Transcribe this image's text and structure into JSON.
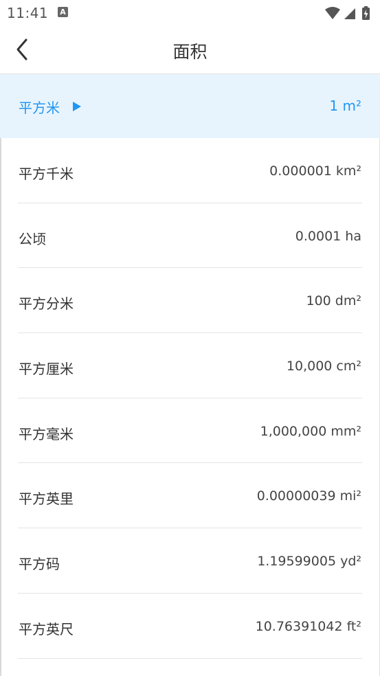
{
  "status_bar": {
    "time": "11:41",
    "app_icon_letter": "A",
    "icons": [
      "wifi-icon",
      "cell-signal-icon",
      "battery-charging-icon"
    ]
  },
  "nav": {
    "title": "面积",
    "back_icon": "chevron-left-icon"
  },
  "selected_unit": {
    "name": "平方米",
    "value": "1 m²",
    "indicator_icon": "triangle-right-icon"
  },
  "units": [
    {
      "name": "平方千米",
      "value": "0.000001 km²"
    },
    {
      "name": "公顷",
      "value": "0.0001 ha"
    },
    {
      "name": "平方分米",
      "value": "100 dm²"
    },
    {
      "name": "平方厘米",
      "value": "10,000 cm²"
    },
    {
      "name": "平方毫米",
      "value": "1,000,000 mm²"
    },
    {
      "name": "平方英里",
      "value": "0.00000039 mi²"
    },
    {
      "name": "平方码",
      "value": "1.19599005 yd²"
    },
    {
      "name": "平方英尺",
      "value": "10.76391042 ft²"
    }
  ],
  "colors": {
    "accent": "#2196f3",
    "selected_background": "#e8f4fd",
    "text": "#333333",
    "divider": "#e4e4e4"
  }
}
